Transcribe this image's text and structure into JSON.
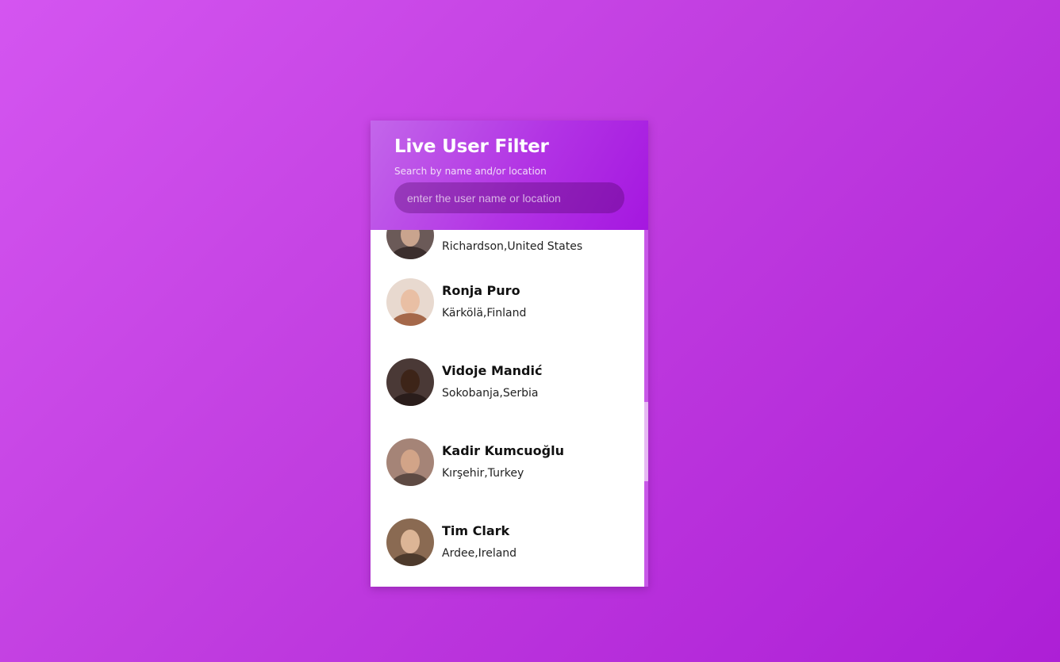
{
  "header": {
    "title": "Live User Filter",
    "subtitle": "Search by name and/or location"
  },
  "search": {
    "placeholder": "enter the user name or location",
    "value": ""
  },
  "users": [
    {
      "name": "",
      "location": "Richardson,United States",
      "avatar": "user-avatar-photo"
    },
    {
      "name": "Ronja Puro",
      "location": "Kärkölä,Finland",
      "avatar": "user-avatar-photo"
    },
    {
      "name": "Vidoje Mandić",
      "location": "Sokobanja,Serbia",
      "avatar": "user-avatar-photo"
    },
    {
      "name": "Kadir Kumcuoğlu",
      "location": "Kırşehir,Turkey",
      "avatar": "user-avatar-photo"
    },
    {
      "name": "Tim Clark",
      "location": "Ardee,Ireland",
      "avatar": "user-avatar-photo"
    }
  ],
  "colors": {
    "background_start": "#d455f0",
    "background_end": "#ad1fd6",
    "header_start": "#c366ea",
    "header_end": "#a517e0",
    "card": "#ffffff"
  }
}
